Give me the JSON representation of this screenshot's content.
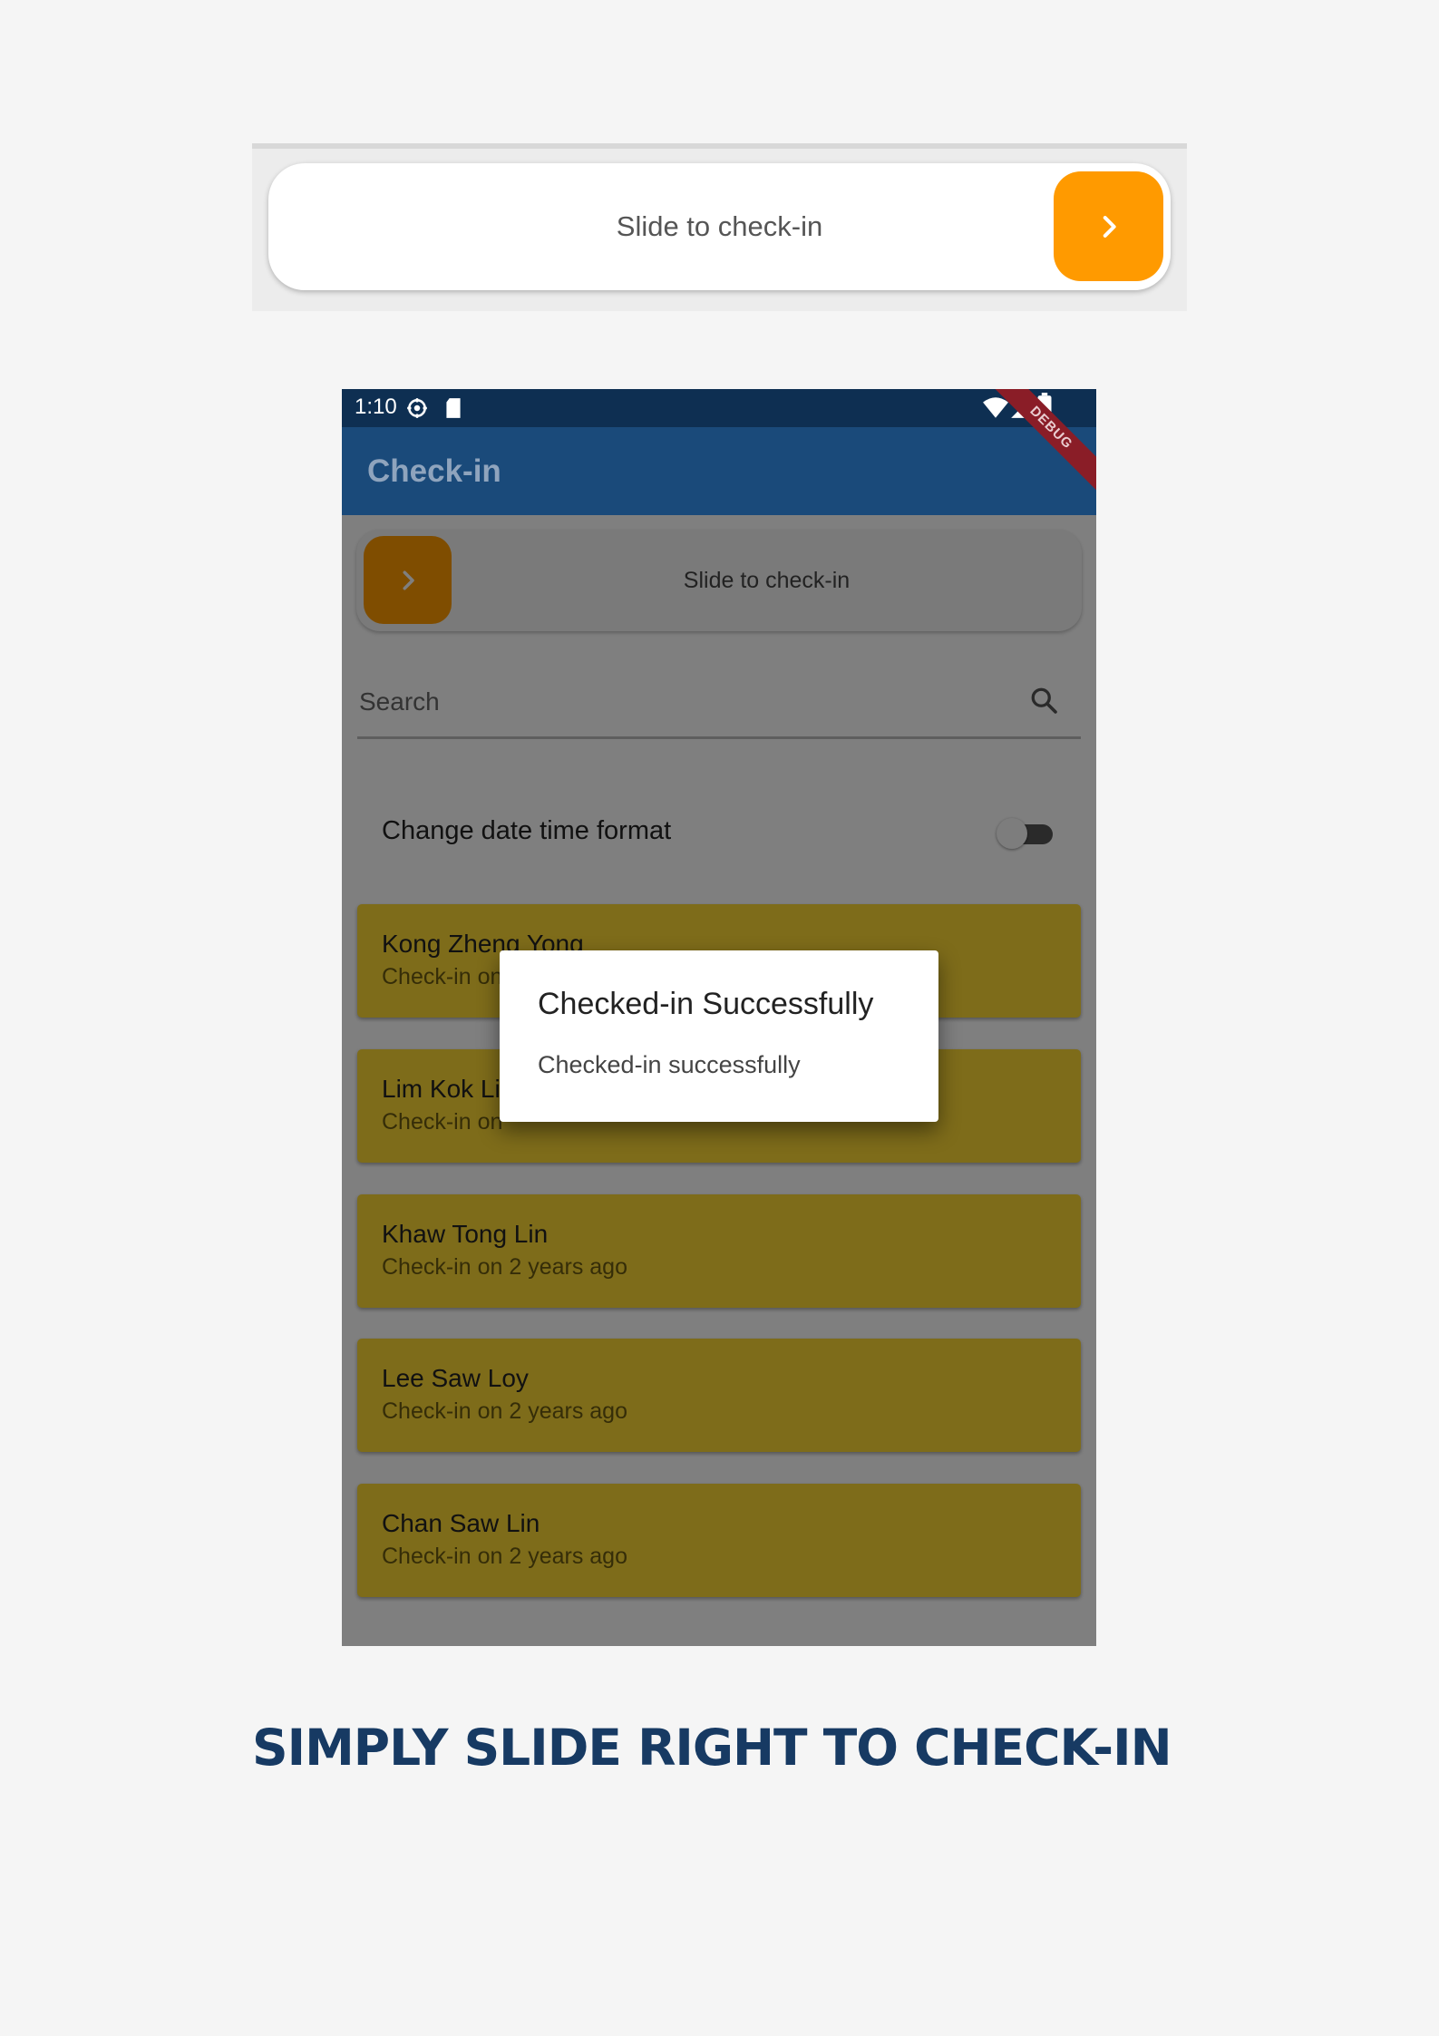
{
  "top_slider": {
    "label": "Slide to check-in",
    "knob_icon": "chevron-right-icon",
    "knob_color": "#ff9a00"
  },
  "status_bar": {
    "time": "1:10",
    "debug_label": "DEBUG"
  },
  "app_bar": {
    "title": "Check-in",
    "color": "#1a4a7a"
  },
  "slider": {
    "label": "Slide to check-in",
    "knob_icon": "chevron-right-icon"
  },
  "search": {
    "placeholder": "Search"
  },
  "date_toggle": {
    "label": "Change date time format",
    "on": false
  },
  "cards": [
    {
      "name": "Kong Zheng Yong",
      "sub": "Check-in on"
    },
    {
      "name": "Lim Kok Li",
      "sub": "Check-in on"
    },
    {
      "name": "Khaw Tong Lin",
      "sub": "Check-in on 2 years ago"
    },
    {
      "name": "Lee Saw Loy",
      "sub": "Check-in on 2 years ago"
    },
    {
      "name": "Chan Saw Lin",
      "sub": "Check-in on 2 years ago"
    }
  ],
  "dialog": {
    "title": "Checked-in Successfully",
    "message": "Checked-in successfully"
  },
  "caption": "SIMPLY SLIDE RIGHT TO CHECK-IN"
}
